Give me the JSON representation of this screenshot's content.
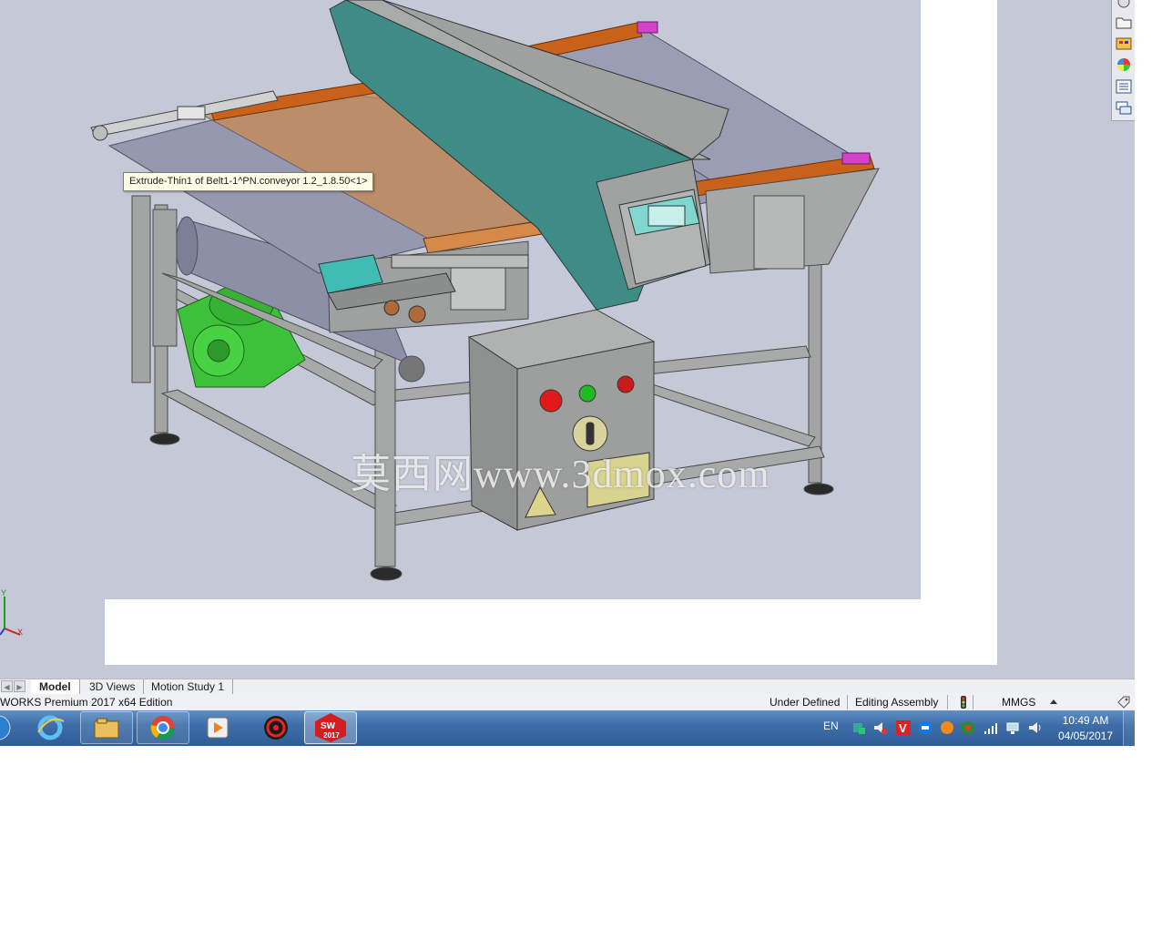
{
  "tooltip": {
    "text": "Extrude-Thin1 of Belt1-1^PN.conveyor 1.2_1.8.50<1>"
  },
  "watermark": {
    "text": "莫西网www.3dmox.com"
  },
  "triad": {
    "y_label": "Y",
    "x_label": "X"
  },
  "tabs": [
    {
      "label": "Model",
      "active": true
    },
    {
      "label": "3D Views",
      "active": false
    },
    {
      "label": "Motion Study 1",
      "active": false
    }
  ],
  "statusbar": {
    "product": "WORKS Premium 2017 x64 Edition",
    "state": "Under Defined",
    "mode": "Editing Assembly",
    "units": "MMGS"
  },
  "taskpane": {
    "icons": [
      "solidworks-resources-icon",
      "design-library-icon",
      "file-explorer-icon",
      "view-palette-icon",
      "appearances-icon",
      "custom-properties-icon",
      "forum-icon"
    ]
  },
  "taskbar": {
    "apps": [
      {
        "name": "start-orb-icon"
      },
      {
        "name": "internet-explorer-icon"
      },
      {
        "name": "file-explorer-icon"
      },
      {
        "name": "chrome-icon"
      },
      {
        "name": "media-player-icon"
      },
      {
        "name": "app-red-icon"
      },
      {
        "name": "solidworks-icon",
        "label": "SW 2017"
      }
    ],
    "language": "EN",
    "clock": {
      "time": "10:49 AM",
      "date": "04/05/2017"
    }
  },
  "colors": {
    "viewport_bg": "#c5c9d7",
    "frame": "#a6a8a8",
    "belt": "#9598ae",
    "tunnel": "#3f8b86",
    "side_rail": "#c8611a",
    "motor": "#3ec13a",
    "control_box": "#9d9e9e",
    "taskbar": "#3f6ea8"
  }
}
